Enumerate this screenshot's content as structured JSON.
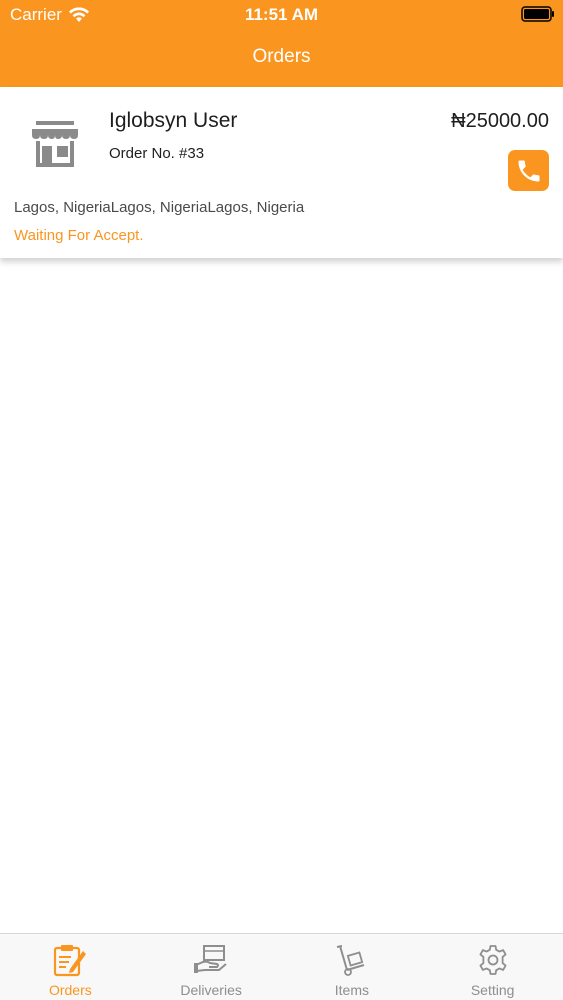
{
  "status_bar": {
    "carrier": "Carrier",
    "time": "11:51 AM"
  },
  "header": {
    "title": "Orders"
  },
  "order": {
    "customer_name": "Iglobsyn User",
    "order_number": "Order No. #33",
    "price": "₦25000.00",
    "address": "Lagos, NigeriaLagos, NigeriaLagos, Nigeria",
    "status": "Waiting For Accept."
  },
  "tabs": [
    {
      "label": "Orders",
      "icon": "orders-clipboard-icon",
      "active": true
    },
    {
      "label": "Deliveries",
      "icon": "delivery-hand-icon",
      "active": false
    },
    {
      "label": "Items",
      "icon": "hand-truck-icon",
      "active": false
    },
    {
      "label": "Setting",
      "icon": "gear-icon",
      "active": false
    }
  ],
  "colors": {
    "brand": "#FA951F",
    "tab_inactive": "#8e8e8e",
    "text_dark": "#1e1e1e"
  }
}
